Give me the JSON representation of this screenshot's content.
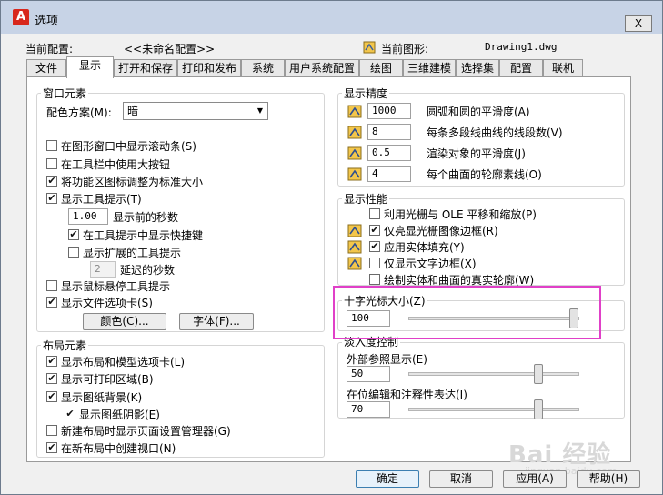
{
  "window": {
    "title": "选项",
    "close": "X"
  },
  "profile": {
    "label": "当前配置:",
    "value": "<<未命名配置>>"
  },
  "drawing": {
    "label": "当前图形:",
    "value": "Drawing1.dwg"
  },
  "tabs": [
    {
      "label": "文件"
    },
    {
      "label": "显示"
    },
    {
      "label": "打开和保存"
    },
    {
      "label": "打印和发布"
    },
    {
      "label": "系统"
    },
    {
      "label": "用户系统配置"
    },
    {
      "label": "绘图"
    },
    {
      "label": "三维建模"
    },
    {
      "label": "选择集"
    },
    {
      "label": "配置"
    },
    {
      "label": "联机"
    }
  ],
  "active_tab": "显示",
  "window_elements": {
    "title": "窗口元素",
    "color_scheme_label": "配色方案(M):",
    "color_scheme_value": "暗",
    "options": [
      {
        "label": "在图形窗口中显示滚动条(S)",
        "checked": false
      },
      {
        "label": "在工具栏中使用大按钮",
        "checked": false
      },
      {
        "label": "将功能区图标调整为标准大小",
        "checked": true
      },
      {
        "label": "显示工具提示(T)",
        "checked": true
      }
    ],
    "tooltip_delay_value": "1.00",
    "tooltip_delay_label": "显示前的秒数",
    "shortcut_tooltip": {
      "label": "在工具提示中显示快捷键",
      "checked": true
    },
    "extended_tooltip": {
      "label": "显示扩展的工具提示",
      "checked": false
    },
    "extended_delay_value": "2",
    "extended_delay_label": "延迟的秒数",
    "rollover_tooltip": {
      "label": "显示鼠标悬停工具提示",
      "checked": false
    },
    "file_tabs": {
      "label": "显示文件选项卡(S)",
      "checked": true
    },
    "colors_button": "颜色(C)...",
    "fonts_button": "字体(F)..."
  },
  "layout_elements": {
    "title": "布局元素",
    "options": [
      {
        "label": "显示布局和模型选项卡(L)",
        "checked": true
      },
      {
        "label": "显示可打印区域(B)",
        "checked": true
      },
      {
        "label": "显示图纸背景(K)",
        "checked": true
      }
    ],
    "paper_shadow": {
      "label": "显示图纸阴影(E)",
      "checked": true
    },
    "more_options": [
      {
        "label": "新建布局时显示页面设置管理器(G)",
        "checked": false
      },
      {
        "label": "在新布局中创建视口(N)",
        "checked": true
      }
    ]
  },
  "display_resolution": {
    "title": "显示精度",
    "items": [
      {
        "value": "1000",
        "label": "圆弧和圆的平滑度(A)"
      },
      {
        "value": "8",
        "label": "每条多段线曲线的线段数(V)"
      },
      {
        "value": "0.5",
        "label": "渲染对象的平滑度(J)"
      },
      {
        "value": "4",
        "label": "每个曲面的轮廓素线(O)"
      }
    ]
  },
  "display_performance": {
    "title": "显示性能",
    "items": [
      {
        "label": "利用光栅与 OLE 平移和缩放(P)",
        "checked": false
      },
      {
        "label": "仅亮显光栅图像边框(R)",
        "checked": true
      },
      {
        "label": "应用实体填充(Y)",
        "checked": true
      },
      {
        "label": "仅显示文字边框(X)",
        "checked": false
      },
      {
        "label": "绘制实体和曲面的真实轮廓(W)",
        "checked": false
      }
    ]
  },
  "crosshair": {
    "title": "十字光标大小(Z)",
    "value": "100"
  },
  "fade_control": {
    "title": "淡入度控制",
    "xref_label": "外部参照显示(E)",
    "xref_value": "50",
    "inplace_label": "在位编辑和注释性表达(I)",
    "inplace_value": "70"
  },
  "footer": {
    "ok": "确定",
    "cancel": "取消",
    "apply": "应用(A)",
    "help": "帮助(H)"
  },
  "watermark": {
    "text": "Bai 经验",
    "sub": "jingyan.baidu.com"
  }
}
